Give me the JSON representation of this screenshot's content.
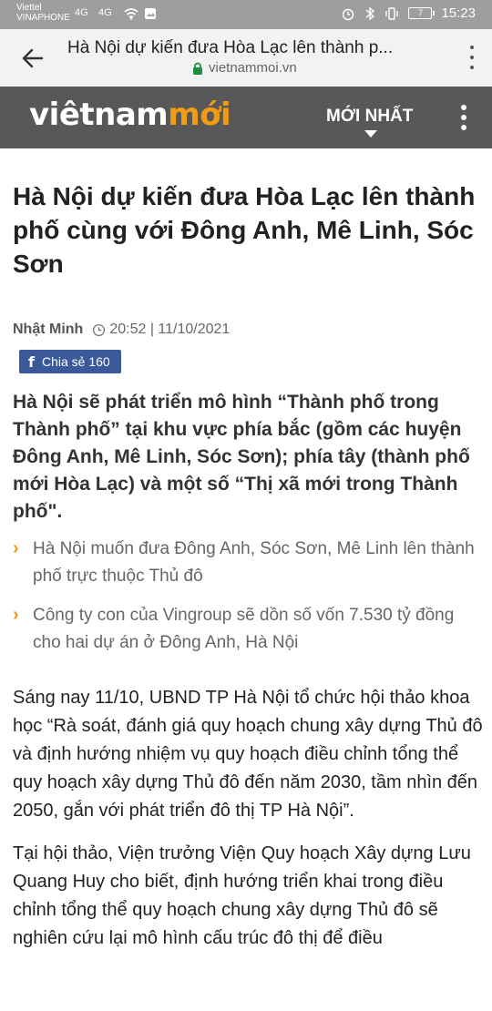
{
  "status_bar": {
    "carrier_1": "Viettel",
    "carrier_2": "VINAPHONE",
    "sig_1": "4G",
    "sig_2": "4G",
    "battery": "7",
    "time": "15:23"
  },
  "browser": {
    "title": "Hà Nội dự kiến đưa Hòa Lạc lên thành p...",
    "url": "vietnammoi.vn",
    "lock_color": "#1e8e3e"
  },
  "site": {
    "logo_white": "viêtnam",
    "logo_orange": "mới",
    "latest_label": "MỚI NHẤT",
    "header_bg": "#585858",
    "accent": "#f39c12"
  },
  "article": {
    "title": "Hà Nội dự kiến đưa Hòa Lạc lên thành phố cùng với Đông Anh, Mê Linh, Sóc Sơn",
    "author": "Nhật Minh",
    "datetime": "20:52 | 11/10/2021",
    "share_label": "Chia sẻ 160",
    "sapo": "Hà Nội sẽ phát triển mô hình “Thành phố trong Thành phố” tại khu vực phía bắc (gồm các huyện Đông Anh, Mê Linh, Sóc Sơn); phía tây (thành phố mới Hòa Lạc) và một số “Thị xã mới trong Thành phố\".",
    "related": [
      "Hà Nội muốn đưa Đông Anh, Sóc Sơn, Mê Linh lên thành phố trực thuộc Thủ đô",
      "Công ty con của Vingroup sẽ dồn số vốn 7.530 tỷ đồng cho hai dự án ở Đông Anh, Hà Nội"
    ],
    "paragraphs": [
      "Sáng nay 11/10, UBND TP Hà Nội tổ chức hội thảo khoa học “Rà soát, đánh giá quy hoạch chung xây dựng Thủ đô và định hướng nhiệm vụ quy hoạch điều chỉnh tổng thể quy hoạch xây dựng Thủ đô đến năm 2030, tầm nhìn đến 2050, gắn với phát triển đô thị TP Hà Nội”.",
      "Tại hội thảo, Viện trưởng Viện Quy hoạch Xây dựng Lưu Quang Huy cho biết, định hướng triển khai trong điều chỉnh tổng thể quy hoạch chung xây dựng Thủ đô sẽ nghiên cứu lại mô hình cấu trúc đô thị để điều"
    ]
  }
}
